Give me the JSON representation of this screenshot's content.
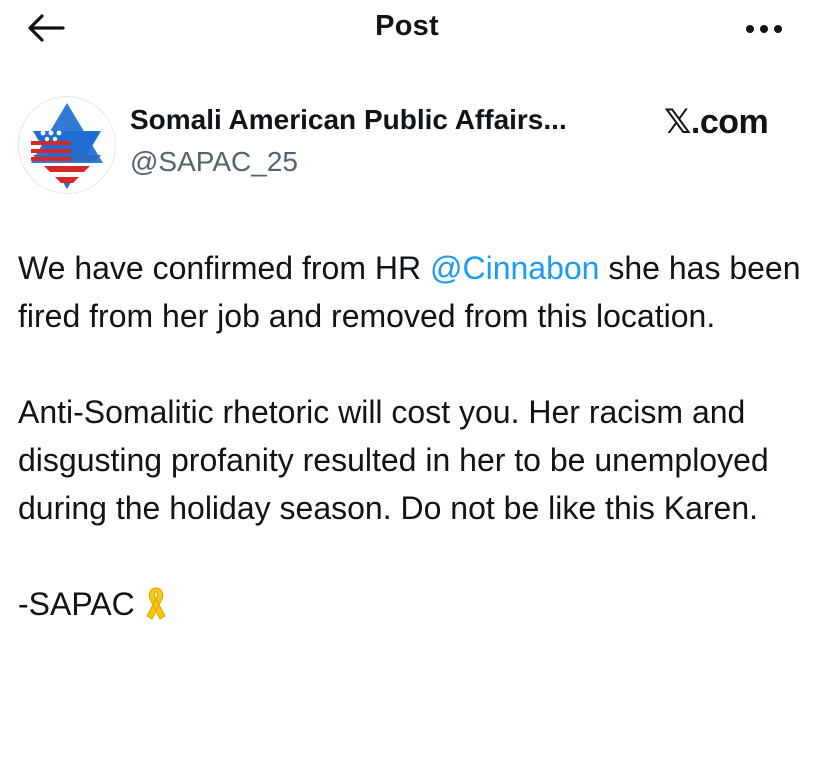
{
  "header": {
    "title": "Post",
    "back_icon": "arrow-left-icon",
    "more_icon": "more-horizontal-icon"
  },
  "author": {
    "display_name": "Somali American Public Affairs...",
    "handle": "@SAPAC_25",
    "avatar_icon": "star-of-david-flag-avatar"
  },
  "watermark": "𝕏.com",
  "post": {
    "p1_before_mention": "We have confirmed from HR ",
    "p1_mention": "@Cinnabon",
    "p1_after_mention": " she has been fired from her job and removed from this location.",
    "p2": "Anti-Somalitic rhetoric will cost you. Her racism and disgusting profanity resulted in her to be unemployed during the holiday season. Do not be like this Karen.",
    "signature": "-SAPAC",
    "signature_icon": "yellow-ribbon-icon"
  },
  "colors": {
    "text": "#0f1419",
    "secondary_text": "#536471",
    "link": "#1d9bf0",
    "avatar_blue": "#1f6fd1",
    "avatar_red": "#d62828",
    "ribbon_yellow": "#f5c518"
  }
}
